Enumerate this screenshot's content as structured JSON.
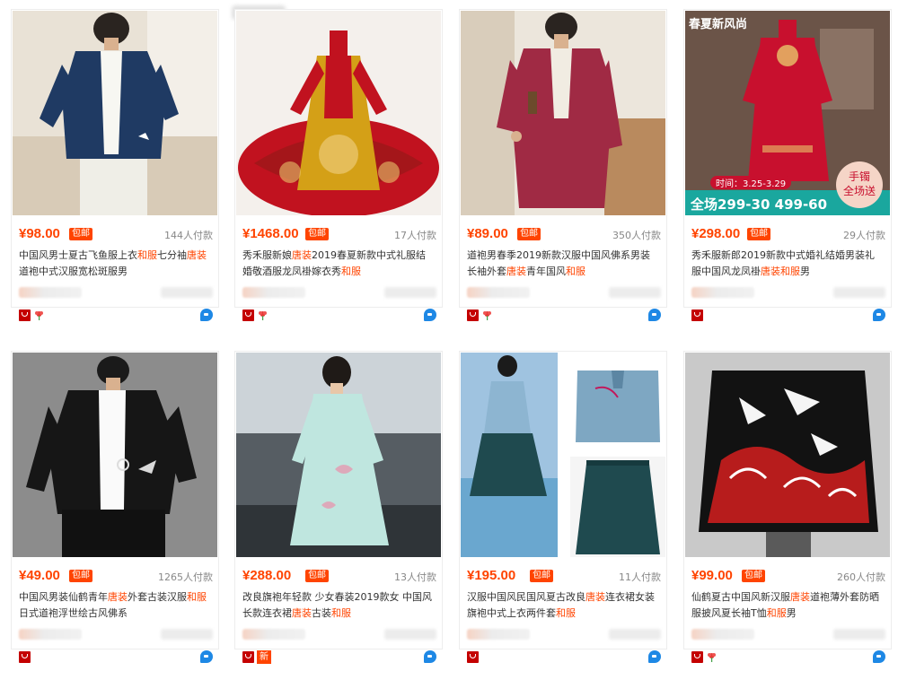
{
  "currency": "¥",
  "badge_free_shipping": "包邮",
  "badge_new": "新",
  "products": [
    {
      "price": "¥98.00",
      "paid": "144人付款",
      "title_parts": [
        "中国风男士夏古飞鱼服上衣",
        "和服",
        "七分袖",
        "唐装",
        "道袍中式汉服宽松斑服男"
      ]
    },
    {
      "price": "¥1468.00",
      "paid": "17人付款",
      "title_parts": [
        "秀禾服新娘",
        "唐装",
        "2019春夏新款中式礼服结婚敬酒服龙凤褂嫁衣秀",
        "和服",
        ""
      ]
    },
    {
      "price": "¥89.00",
      "paid": "350人付款",
      "title_parts": [
        "道袍男春季2019新款汉服中国风佛系男装长袖外套",
        "唐装",
        "青年国风",
        "和服",
        ""
      ]
    },
    {
      "price": "¥298.00",
      "paid": "29人付款",
      "title_parts": [
        "秀禾服新郎2019新款中式婚礼结婚男装礼服中国风龙凤褂",
        "唐装",
        "",
        "和服",
        "男"
      ],
      "overlay": {
        "top_text": "春夏新风尚",
        "date_text": "时间：3.25-3.29",
        "bottom_text": "全场299-30  499-60",
        "circle_top": "手镯",
        "circle_bottom": "全场送"
      }
    },
    {
      "price": "¥49.00",
      "paid": "1265人付款",
      "title_parts": [
        "中国风男装仙鹤青年",
        "唐装",
        "外套古装汉服",
        "和服",
        "日式道袍浮世绘古风佛系"
      ]
    },
    {
      "price": "¥288.00",
      "paid": "13人付款",
      "title_parts": [
        "改良旗袍年轻款 少女春装2019款女 中国风长款连衣裙",
        "唐装",
        "古装",
        "和服",
        ""
      ]
    },
    {
      "price": "¥195.00",
      "paid": "11人付款",
      "title_parts": [
        "汉服中国风民国风夏古改良",
        "唐装",
        "连衣裙女装旗袍中式上衣两件套",
        "和服",
        ""
      ]
    },
    {
      "price": "¥99.00",
      "paid": "260人付款",
      "title_parts": [
        "仙鹤夏古中国风新汉服",
        "唐装",
        "道袍薄外套防晒服披风夏长袖T恤",
        "和服",
        "男"
      ]
    }
  ],
  "colors": {
    "accent": "#ff4400",
    "tmall": "#c40000",
    "wangwang": "#1e88e5"
  }
}
